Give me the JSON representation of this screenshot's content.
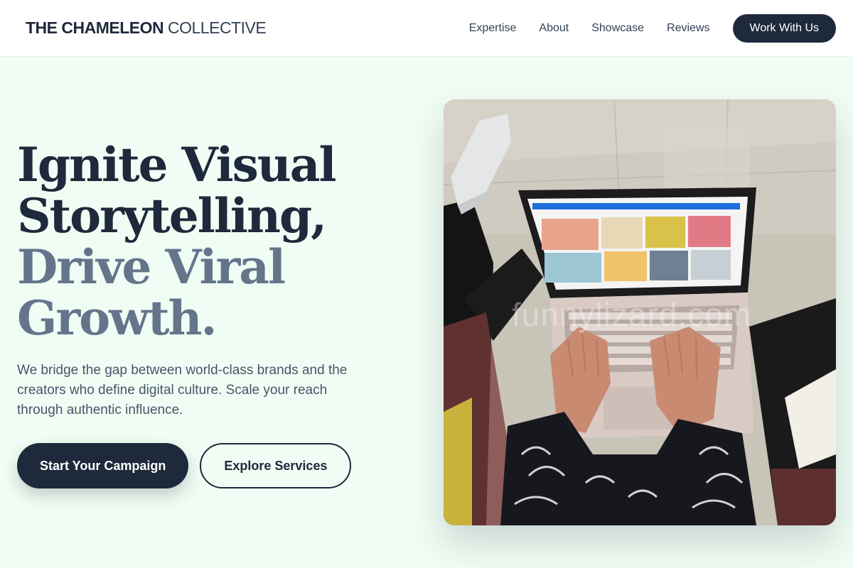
{
  "brand": {
    "strong": "THE CHAMELEON",
    "light": "COLLECTIVE"
  },
  "nav": {
    "items": [
      {
        "label": "Expertise"
      },
      {
        "label": "About"
      },
      {
        "label": "Showcase"
      },
      {
        "label": "Reviews"
      }
    ],
    "cta": "Work With Us"
  },
  "hero": {
    "headline": {
      "line1": "Ignite Visual",
      "line2": "Storytelling,",
      "line3": "Drive Viral",
      "line4": "Growth."
    },
    "subtext": "We bridge the gap between world-class brands and the creators who define digital culture. Scale your reach through authentic influence.",
    "primary_button": "Start Your Campaign",
    "secondary_button": "Explore Services",
    "image": {
      "watermark": "funnylizard.com",
      "subject": "person-typing-on-laptop-photo"
    }
  },
  "colors": {
    "page_background": "#f0fdf4",
    "navy": "#1e293b",
    "slate_accent": "#64748b",
    "body_text": "#475569"
  }
}
